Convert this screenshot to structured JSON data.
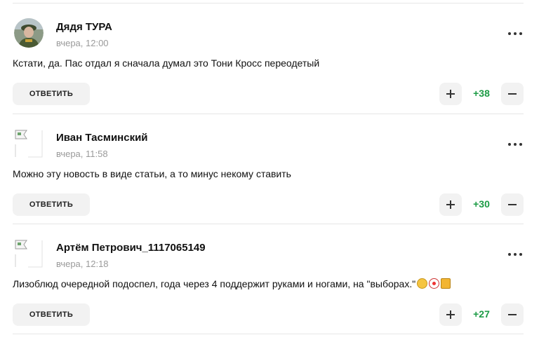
{
  "comments": [
    {
      "author": "Дядя ТУРА",
      "time": "вчера, 12:00",
      "text": "Кстати, да. Пас отдал я сначала думал это Тони Кросс переодетый",
      "reply_label": "ОТВЕТИТЬ",
      "score": "+38",
      "avatar": "photo-avatar"
    },
    {
      "author": "Иван Тасминский",
      "time": "вчера, 11:58",
      "text": "Можно эту новость в виде статьи, а то минус некому ставить",
      "reply_label": "ОТВЕТИТЬ",
      "score": "+30",
      "avatar": "broken-image-avatar"
    },
    {
      "author": "Артём Петрович_1117065149",
      "time": "вчера, 12:18",
      "text": "Лизоблюд очередной подоспел, года через 4 поддержит руками и ногами, на \"выборах.\"",
      "reply_label": "ОТВЕТИТЬ",
      "score": "+27",
      "avatar": "broken-image-avatar",
      "emojis": [
        "smirk-emoji",
        "clown-emoji",
        "thumbs-down-emoji"
      ]
    }
  ],
  "colors": {
    "score": "#1c9b45",
    "button_bg": "#f2f2f2",
    "time": "#9a9a9a",
    "separator": "#e6e6e6"
  }
}
